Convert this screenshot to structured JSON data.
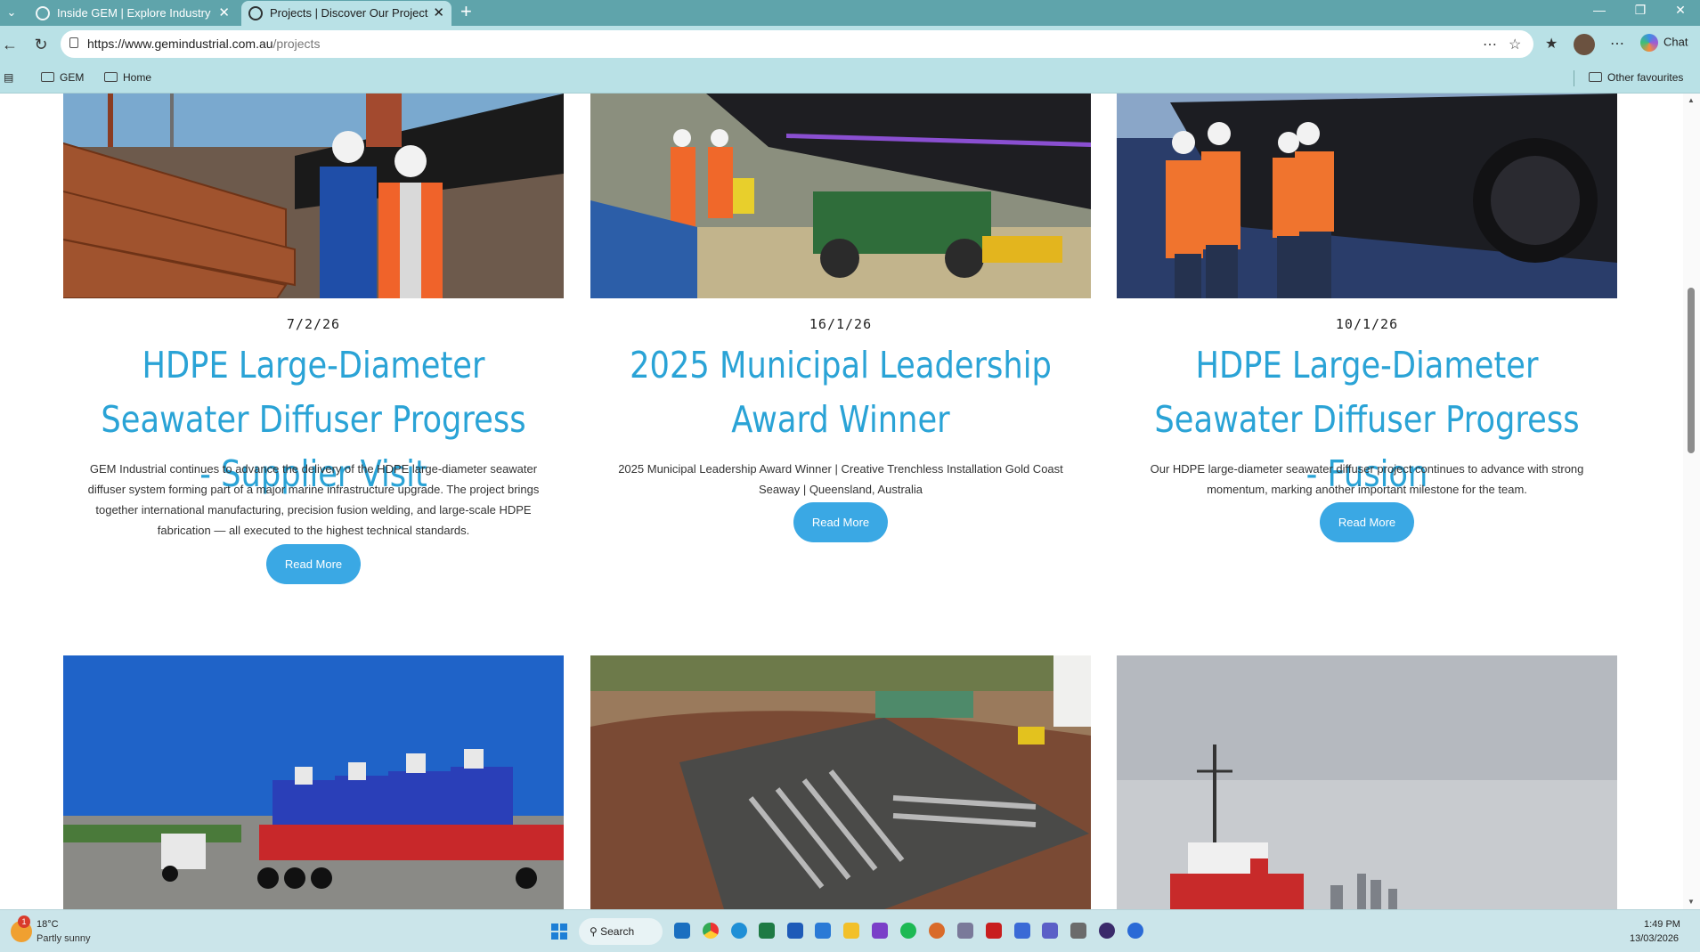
{
  "browser": {
    "tabs": [
      {
        "title": "Inside GEM | Explore Industry Insig",
        "active": false
      },
      {
        "title": "Projects | Discover Our Projects To",
        "active": true
      }
    ],
    "url": {
      "host": "https://www.gemindustrial.com.au",
      "path": "/projects"
    },
    "chat_label": "Chat",
    "favourites": [
      "GEM",
      "Home"
    ],
    "other_favourites": "Other favourites"
  },
  "cards": [
    {
      "date": "7/2/26",
      "title": "HDPE Large-Diameter Seawater Diffuser Progress - Supplier Visit",
      "description": "GEM Industrial continues to advance the delivery of the HDPE large-diameter seawater diffuser system forming part of a major marine infrastructure upgrade. The project brings together international manufacturing, precision fusion welding, and large-scale HDPE fabrication — all executed to the highest technical standards.",
      "button": "Read More"
    },
    {
      "date": "16/1/26",
      "title": "2025 Municipal Leadership Award Winner",
      "description": "2025 Municipal Leadership Award Winner | Creative Trenchless Installation Gold Coast Seaway | Queensland, Australia",
      "button": "Read More"
    },
    {
      "date": "10/1/26",
      "title": "HDPE Large-Diameter Seawater Diffuser Progress - Fusion",
      "description": "Our HDPE large-diameter seawater diffuser project continues to advance with strong momentum, marking another important milestone for the team.",
      "button": "Read More"
    }
  ],
  "taskbar": {
    "weather_temp": "18°C",
    "weather_desc": "Partly sunny",
    "weather_badge": "1",
    "search_label": "Search",
    "time": "1:49 PM",
    "date": "13/03/2026"
  },
  "colors": {
    "accent": "#2aa3d6",
    "button": "#3aa8e4",
    "chrome": "#b9e1e6",
    "tabbar": "#5fa4ab"
  }
}
